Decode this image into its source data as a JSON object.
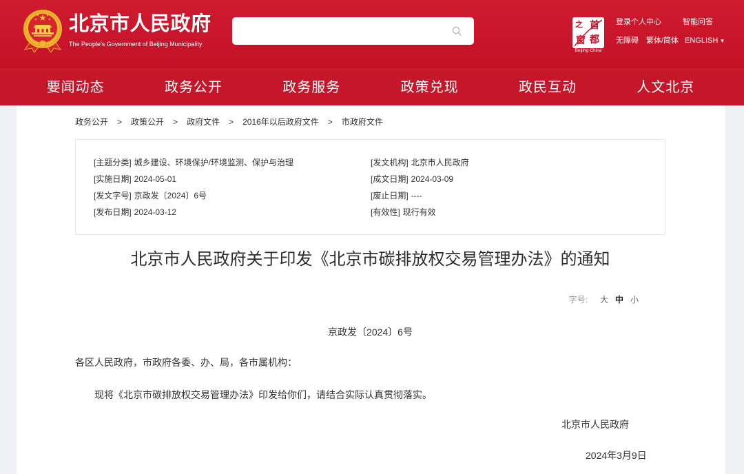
{
  "header": {
    "site_title": "北京市人民政府",
    "site_subtitle": "The People's Government of Beijing Municipality",
    "portal_logo": {
      "chars": [
        "之",
        "首",
        "窗",
        "都"
      ],
      "caption": "Beijing·China"
    },
    "links": {
      "login": "登录个人中心",
      "smart_qa": "智能问答",
      "accessibility": "无障碍",
      "script_toggle": "繁体/简体",
      "english": "ENGLISH",
      "english_caret": "▾"
    }
  },
  "nav": [
    {
      "label": "要闻动态"
    },
    {
      "label": "政务公开"
    },
    {
      "label": "政务服务"
    },
    {
      "label": "政策兑现"
    },
    {
      "label": "政民互动"
    },
    {
      "label": "人文北京"
    }
  ],
  "breadcrumb": {
    "separator": ">",
    "items": [
      "政务公开",
      "政策公开",
      "政府文件",
      "2016年以后政府文件",
      "市政府文件"
    ]
  },
  "document_info": [
    [
      {
        "label": "[主题分类]",
        "value": "城乡建设、环境保护/环境监测、保护与治理"
      },
      {
        "label": "[发文机构]",
        "value": "北京市人民政府"
      }
    ],
    [
      {
        "label": "[实施日期]",
        "value": "2024-05-01"
      },
      {
        "label": "[成文日期]",
        "value": "2024-03-09"
      }
    ],
    [
      {
        "label": "[发文字号]",
        "value": "京政发〔2024〕6号"
      },
      {
        "label": "[废止日期]",
        "value": "----"
      }
    ],
    [
      {
        "label": "[发布日期]",
        "value": "2024-03-12"
      },
      {
        "label": "[有效性]",
        "value": "现行有效"
      }
    ]
  ],
  "article": {
    "title": "北京市人民政府关于印发《北京市碳排放权交易管理办法》的通知",
    "font_size_label": "字号:",
    "font_sizes": [
      {
        "label": "大",
        "selected": false
      },
      {
        "label": "中",
        "selected": true
      },
      {
        "label": "小",
        "selected": false
      }
    ],
    "doc_number": "京政发〔2024〕6号",
    "salutation": "各区人民政府，市政府各委、办、局，各市属机构：",
    "body": "现将《北京市碳排放权交易管理办法》印发给你们，请结合实际认真贯彻落实。",
    "signature": "北京市人民政府",
    "date": "2024年3月9日"
  },
  "icons": {
    "emblem": "national-emblem-icon",
    "search": "search-icon",
    "portal_logo": "capital-window-logo",
    "caret": "caret-down-icon"
  },
  "colors": {
    "brand_red": "#c8152b",
    "nav_red": "#c6172a",
    "text": "#333333",
    "muted": "#999999",
    "page_bg": "#eef0f3",
    "border": "#e6e6e6"
  }
}
